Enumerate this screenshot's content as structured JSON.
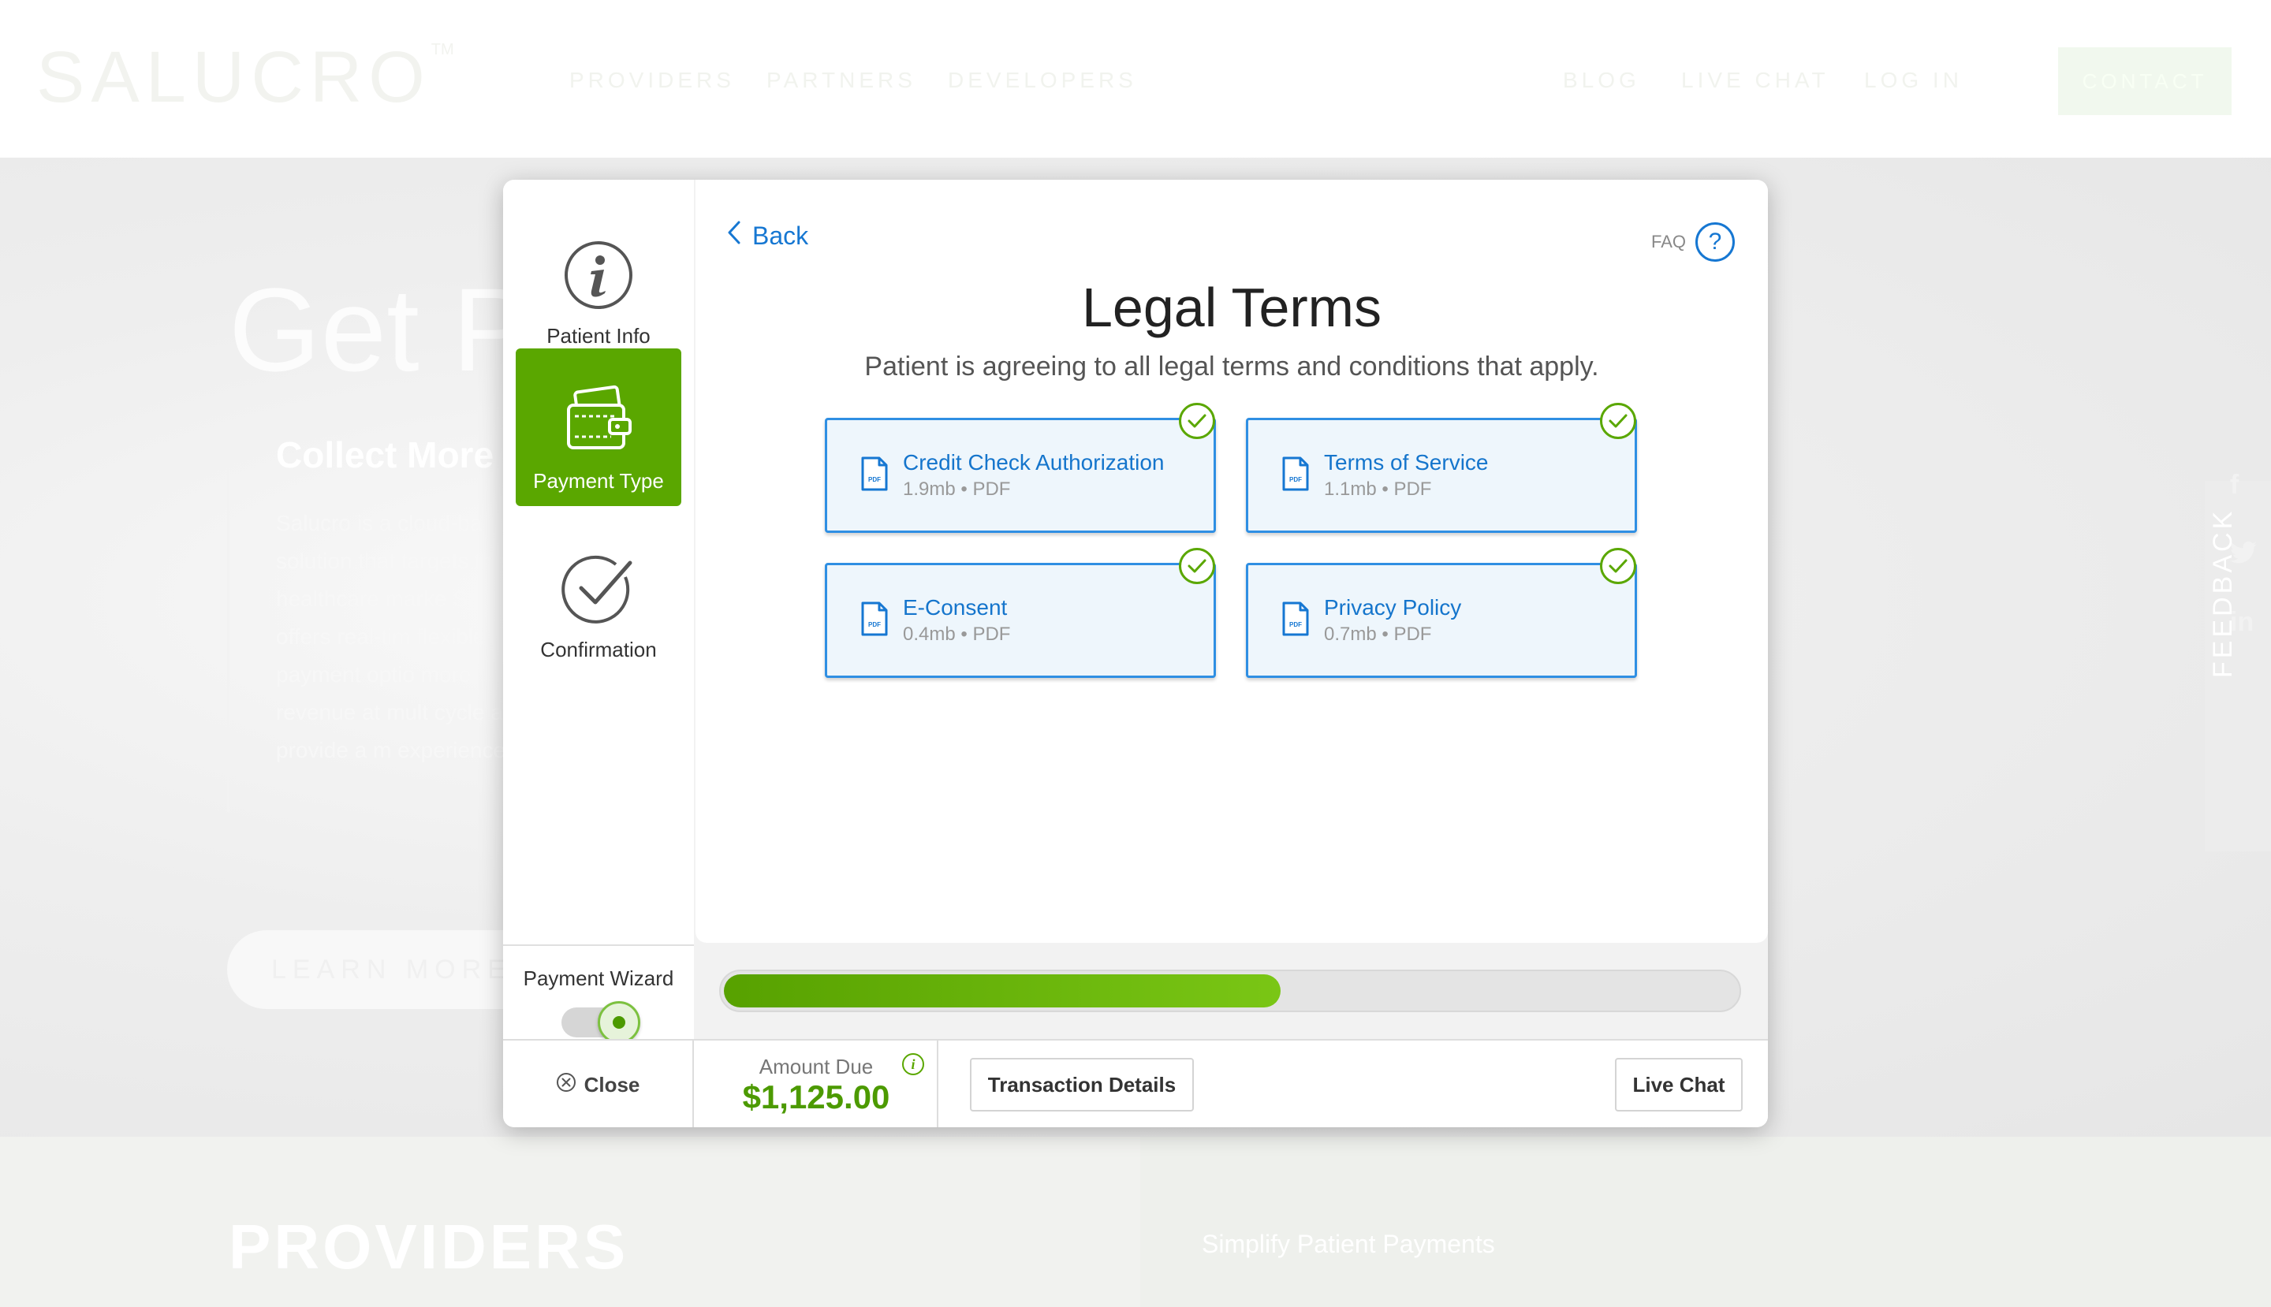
{
  "site": {
    "logo": "SALUCRO",
    "logo_tm": "TM",
    "nav_left": [
      "PROVIDERS",
      "PARTNERS",
      "DEVELOPERS"
    ],
    "nav_right": [
      "BLOG",
      "LIVE CHAT",
      "LOG IN"
    ],
    "contact": "CONTACT",
    "hero_title": "Get Pa",
    "hero_sub": "Collect More",
    "hero_text": "Salucro is a cloud-ba solution that targets the healthcare marke Salucro offers real-tim flexible payment optio more revenue at mult cycle and provide a m experience.",
    "learn_more": "LEARN MORE",
    "feedback": "FEEDBACK",
    "providers": "PROVIDERS",
    "providers_right": "Simplify Patient Payments"
  },
  "sidebar": {
    "steps": [
      {
        "label": "Patient Info",
        "icon": "info-icon"
      },
      {
        "label": "Payment Type",
        "icon": "wallet-icon",
        "active": true
      },
      {
        "label": "Confirmation",
        "icon": "check-circle-icon"
      }
    ]
  },
  "content": {
    "back": "Back",
    "faq": "FAQ",
    "faq_icon": "?",
    "title": "Legal Terms",
    "subtitle": "Patient is agreeing to all legal terms and conditions that apply.",
    "documents": [
      {
        "name": "Credit Check Authorization",
        "meta": "1.9mb • PDF",
        "checked": true
      },
      {
        "name": "Terms of Service",
        "meta": "1.1mb • PDF",
        "checked": true
      },
      {
        "name": "E-Consent",
        "meta": "0.4mb • PDF",
        "checked": true
      },
      {
        "name": "Privacy Policy",
        "meta": "0.7mb • PDF",
        "checked": true
      }
    ],
    "pdf_tag": "PDF"
  },
  "wizard": {
    "label": "Payment Wizard",
    "enabled": true
  },
  "progress": {
    "fraction": 0.55
  },
  "footer": {
    "close": "Close",
    "amount_label": "Amount Due",
    "amount_value": "$1,125.00",
    "info_icon": "i",
    "transaction_details": "Transaction Details",
    "live_chat": "Live Chat"
  },
  "colors": {
    "accent_green": "#5aa700",
    "link_blue": "#1677d2",
    "card_border": "#2f8fe3"
  }
}
